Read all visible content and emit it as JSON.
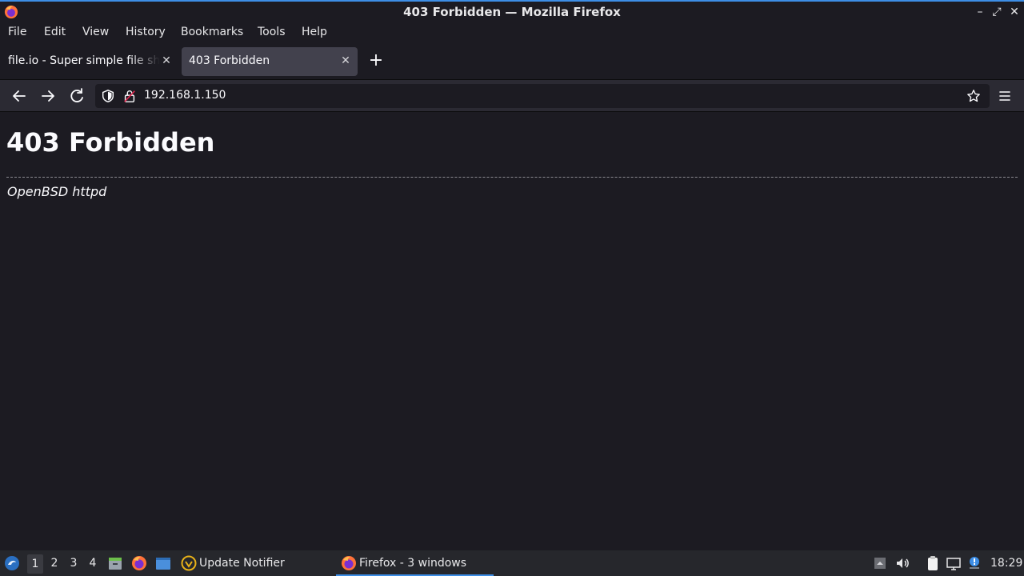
{
  "window": {
    "title": "403 Forbidden — Mozilla Firefox",
    "minimize_glyph": "–",
    "maximize_glyph": "⤢",
    "close_glyph": "✕"
  },
  "menubar": {
    "items": [
      {
        "label": "File"
      },
      {
        "label": "Edit"
      },
      {
        "label": "View"
      },
      {
        "label": "History"
      },
      {
        "label": "Bookmarks"
      },
      {
        "label": "Tools"
      },
      {
        "label": "Help"
      }
    ]
  },
  "tabs": [
    {
      "label": "file.io - Super simple file sharing",
      "active": false,
      "close_glyph": "✕"
    },
    {
      "label": "403 Forbidden",
      "active": true,
      "close_glyph": "✕"
    }
  ],
  "new_tab_glyph": "+",
  "navbar": {
    "url": "192.168.1.150"
  },
  "page": {
    "heading": "403 Forbidden",
    "server_signature": "OpenBSD httpd"
  },
  "taskbar": {
    "workspaces": [
      "1",
      "2",
      "3",
      "4"
    ],
    "active_workspace": "1",
    "update_notifier_label": "Update Notifier",
    "firefox_label": "Firefox - 3 windows",
    "clock": "18:29"
  },
  "colors": {
    "accent": "#3d8ee6",
    "page_bg": "#1c1b22",
    "toolbar_bg": "#2b2a33",
    "active_tab_bg": "#42414d"
  }
}
